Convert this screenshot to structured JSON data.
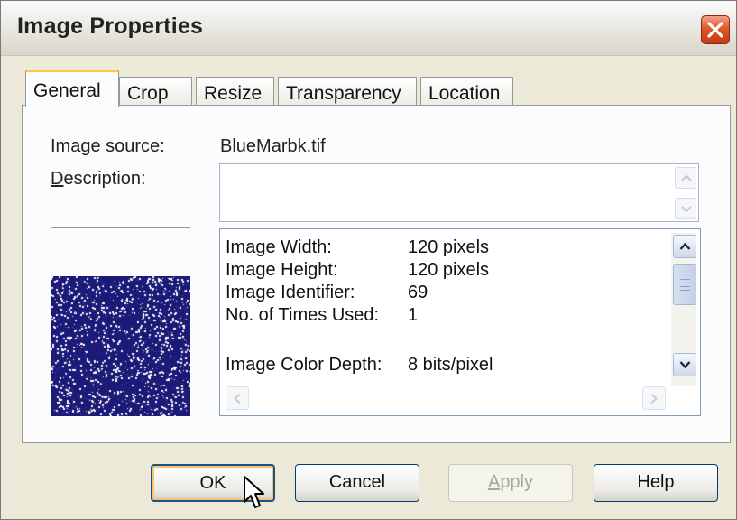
{
  "window": {
    "title": "Image Properties"
  },
  "tabs": [
    {
      "label": "General",
      "active": true
    },
    {
      "label": "Crop",
      "active": false
    },
    {
      "label": "Resize",
      "active": false
    },
    {
      "label": "Transparency",
      "active": false
    },
    {
      "label": "Location",
      "active": false
    }
  ],
  "general": {
    "image_source_label": "Image source:",
    "image_source_value": "BlueMarbk.tif",
    "description_label_mnemonic": "D",
    "description_label_rest": "escription:",
    "description_value": ""
  },
  "info": [
    {
      "label": "Image Width:",
      "value": "120 pixels"
    },
    {
      "label": "Image Height:",
      "value": "120 pixels"
    },
    {
      "label": "Image Identifier:",
      "value": "69"
    },
    {
      "label": "No. of Times Used:",
      "value": "1"
    },
    {
      "label": "Image Color Depth:",
      "value": "8 bits/pixel"
    }
  ],
  "buttons": {
    "ok": "OK",
    "cancel": "Cancel",
    "apply_mnemonic": "A",
    "apply_rest": "pply",
    "help": "Help"
  },
  "colors": {
    "dialog_bg": "#ece9d8",
    "active_tab_accent": "#ffc83c",
    "preview_blue": "#1a1a78",
    "close_red": "#e2552c"
  },
  "icons": [
    "close-icon",
    "scroll-up-icon",
    "scroll-down-icon",
    "scroll-left-icon",
    "scroll-right-icon",
    "mouse-cursor-icon"
  ]
}
